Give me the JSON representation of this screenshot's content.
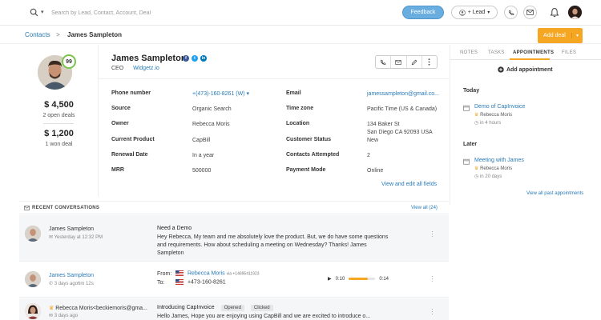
{
  "search": {
    "placeholder": "Search by Lead, Contact, Account, Deal"
  },
  "header": {
    "feedback_label": "Feedback",
    "lead_label": "+ Lead"
  },
  "breadcrumb": {
    "root": "Contacts",
    "separator": ">",
    "current": "James Sampleton"
  },
  "actions": {
    "add_deal_label": "Add deal"
  },
  "summary": {
    "score": "99",
    "open_amount": "$ 4,500",
    "open_label": "2 open deals",
    "won_amount": "$ 1,200",
    "won_label": "1 won deal"
  },
  "contact": {
    "name": "James Sampleton",
    "title": "CEO",
    "company": "Widgetz.io",
    "social": [
      "f",
      "t",
      "in"
    ],
    "fields_left": [
      {
        "label": "Phone number",
        "value": "+(473)-160-8261 (W) ▾",
        "link": true
      },
      {
        "label": "Source",
        "value": "Organic Search"
      },
      {
        "label": "Owner",
        "value": "Rebecca Moris"
      },
      {
        "label": "Current Product",
        "value": "CapBill"
      },
      {
        "label": "Renewal Date",
        "value": "In a year"
      },
      {
        "label": "MRR",
        "value": "500000"
      }
    ],
    "fields_right": [
      {
        "label": "Email",
        "value": "jamessampleton@gmail.co...",
        "link": true
      },
      {
        "label": "Time zone",
        "value": "Pacific Time (US & Canada)"
      },
      {
        "label": "Location",
        "value": "134 Baker St\nSan Diego CA 92093 USA"
      },
      {
        "label": "Customer Status",
        "value": "New"
      },
      {
        "label": "Contacts Attempted",
        "value": "2"
      },
      {
        "label": "Payment Mode",
        "value": "Online"
      }
    ],
    "view_all_label": "View and edit all fields"
  },
  "tabs": [
    {
      "label": "NOTES"
    },
    {
      "label": "TASKS"
    },
    {
      "label": "APPOINTMENTS",
      "active": true
    },
    {
      "label": "FILES"
    }
  ],
  "appointments": {
    "add_label": "Add appointment",
    "today_label": "Today",
    "later_label": "Later",
    "today": {
      "title": "Demo of CapInvoice",
      "owner": "Rebecca Moris",
      "time": "in 4 hours"
    },
    "later": {
      "title": "Meeting with James",
      "owner": "Rebecca Moris",
      "time": "in 20 days"
    },
    "past_label": "View all past appointments"
  },
  "conversations": {
    "title": "RECENT CONVERSATIONS",
    "view_all": "View all (24)",
    "items": [
      {
        "name": "James Sampleton",
        "when": "Yesterday at 12:32 PM",
        "subject": "Need a Demo",
        "body": "Hey Rebecca, My team and me absolutely love the product. But, we do have some questions and requirements. How about scheduling a meeting on Wednesday? Thanks! James Sampleton"
      },
      {
        "name": "James Sampleton",
        "when": "3 days ago6m 12s",
        "from_label": "From:",
        "to_label": "To:",
        "from_name": "Rebecca Moris",
        "from_via": "via +14695411923",
        "to_number": "+473-160-8261",
        "elapsed": "0:10",
        "duration": "0:14",
        "progress": 0.71
      },
      {
        "name": "Rebecca Moris<beckiemoris@gma...",
        "when": "3 days ago",
        "subject": "Introducing CapInvoice",
        "badges": [
          "Opened",
          "Clicked"
        ],
        "body": "Hello James, Hope you are enjoying using CapBill and we are excited to introduce o..."
      }
    ]
  },
  "colors": {
    "accent": "#f5a623",
    "link": "#2a7ab6",
    "feedback": "#6aaee0",
    "score_ring": "#7cc44c"
  }
}
